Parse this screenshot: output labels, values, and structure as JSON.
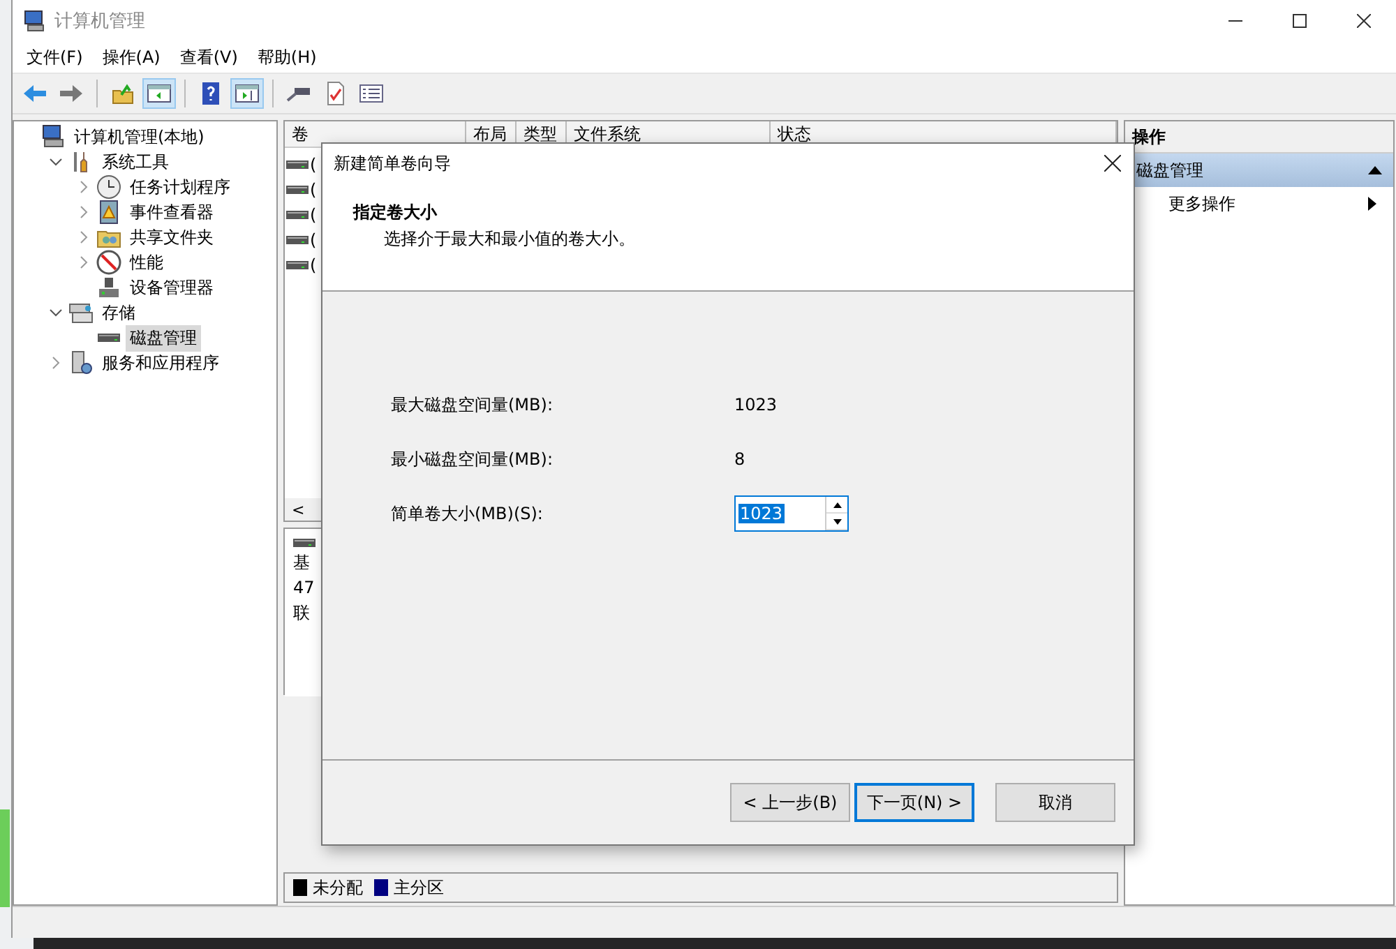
{
  "window": {
    "title": "计算机管理"
  },
  "menu": [
    "文件(F)",
    "操作(A)",
    "查看(V)",
    "帮助(H)"
  ],
  "toolbar": [
    {
      "kind": "back",
      "pressed": false
    },
    {
      "kind": "forward",
      "pressed": false
    },
    {
      "kind": "sep"
    },
    {
      "kind": "up",
      "pressed": false
    },
    {
      "kind": "tree",
      "pressed": true
    },
    {
      "kind": "sep"
    },
    {
      "kind": "help",
      "pressed": false
    },
    {
      "kind": "pane",
      "pressed": true
    },
    {
      "kind": "sep"
    },
    {
      "kind": "connect",
      "pressed": false
    },
    {
      "kind": "check",
      "pressed": false
    },
    {
      "kind": "list",
      "pressed": false
    }
  ],
  "tree": [
    {
      "label": "计算机管理(本地)",
      "kind": "computer",
      "selected": false,
      "children": [
        {
          "label": "系统工具",
          "kind": "tools",
          "expanded": true,
          "selected": false,
          "children": [
            {
              "label": "任务计划程序",
              "kind": "clock",
              "expanded": false,
              "selected": false
            },
            {
              "label": "事件查看器",
              "kind": "event",
              "expanded": false,
              "selected": false
            },
            {
              "label": "共享文件夹",
              "kind": "share",
              "expanded": false,
              "selected": false
            },
            {
              "label": "性能",
              "kind": "perf",
              "expanded": false,
              "selected": false
            },
            {
              "label": "设备管理器",
              "kind": "device",
              "selected": false
            }
          ]
        },
        {
          "label": "存储",
          "kind": "storage",
          "expanded": true,
          "selected": false,
          "children": [
            {
              "label": "磁盘管理",
              "kind": "disk",
              "selected": true
            }
          ]
        },
        {
          "label": "服务和应用程序",
          "kind": "services",
          "expanded": false,
          "selected": false
        }
      ]
    }
  ],
  "volumes": {
    "columns": [
      "卷",
      "布局",
      "类型",
      "文件系统",
      "状态"
    ],
    "rows": [
      "(",
      "(",
      "(",
      "(",
      "("
    ],
    "scroll_left": "<"
  },
  "disk": {
    "lines": [
      "基",
      "47",
      "联"
    ]
  },
  "legend": [
    {
      "label": "未分配",
      "color": "#000000"
    },
    {
      "label": "主分区",
      "color": "#000080"
    }
  ],
  "actions": {
    "title": "操作",
    "section": "磁盘管理",
    "items": [
      "更多操作"
    ]
  },
  "dialog": {
    "title": "新建简单卷向导",
    "heading": "指定卷大小",
    "subtitle": "选择介于最大和最小值的卷大小。",
    "fields": [
      {
        "kind": "readout",
        "label": "最大磁盘空间量(MB):",
        "value": "1023"
      },
      {
        "kind": "readout",
        "label": "最小磁盘空间量(MB):",
        "value": "8"
      },
      {
        "kind": "spin",
        "label": "简单卷大小(MB)(S):",
        "value": "1023"
      }
    ],
    "buttons": [
      {
        "label": "< 上一步(B)",
        "default": false
      },
      {
        "label": "下一页(N) >",
        "default": true
      },
      {
        "label": "取消",
        "default": false
      }
    ]
  }
}
